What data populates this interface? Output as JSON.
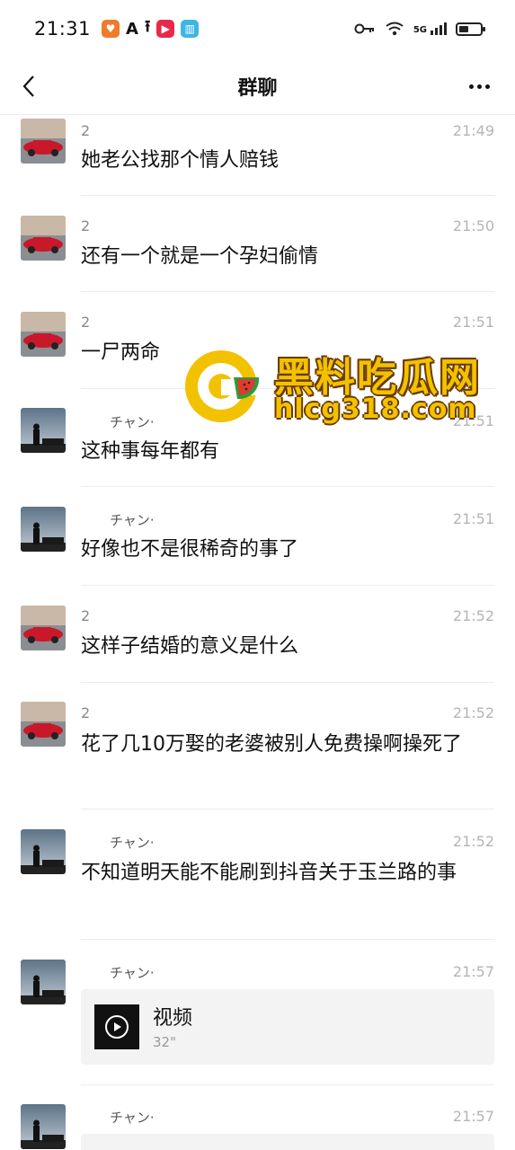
{
  "status_bar": {
    "time": "21:31",
    "network": "5G",
    "app_icons": [
      "app-icon-orange",
      "app-icon-a",
      "upload-icon",
      "video-app-icon",
      "book-app-icon"
    ]
  },
  "nav": {
    "title": "群聊"
  },
  "messages": [
    {
      "sender": "2",
      "time": "21:49",
      "text": "她老公找那个情人赔钱",
      "avatar": "red-car-avatar"
    },
    {
      "sender": "2",
      "time": "21:50",
      "text": "还有一个就是一个孕妇偷情",
      "avatar": "red-car-avatar"
    },
    {
      "sender": "2",
      "time": "21:51",
      "text": "一尸两命",
      "avatar": "red-car-avatar"
    },
    {
      "sender": "チャン·",
      "time": "21:51",
      "text": "这种事每年都有",
      "avatar": "night-person-avatar"
    },
    {
      "sender": "チャン·",
      "time": "21:51",
      "text": "好像也不是很稀奇的事了",
      "avatar": "night-person-avatar"
    },
    {
      "sender": "2",
      "time": "21:52",
      "text": "这样子结婚的意义是什么",
      "avatar": "red-car-avatar"
    },
    {
      "sender": "2",
      "time": "21:52",
      "text": "花了几10万娶的老婆被别人免费操啊操死了",
      "avatar": "red-car-avatar"
    },
    {
      "sender": "チャン·",
      "time": "21:52",
      "text": "不知道明天能不能刷到抖音关于玉兰路的事",
      "avatar": "night-person-avatar"
    },
    {
      "sender": "チャン·",
      "time": "21:57",
      "video_title": "视频",
      "video_duration": "32\"",
      "avatar": "night-person-avatar"
    },
    {
      "sender": "チャン·",
      "time": "21:57",
      "avatar": "night-person-avatar"
    }
  ],
  "watermark": {
    "title": "黑料吃瓜网",
    "url": "hlcg318.com"
  },
  "colors": {
    "background": "#ffffff",
    "time_gray": "#b5b5b5",
    "card_gray": "#f3f3f3",
    "watermark_yellow": "#f2c200"
  }
}
